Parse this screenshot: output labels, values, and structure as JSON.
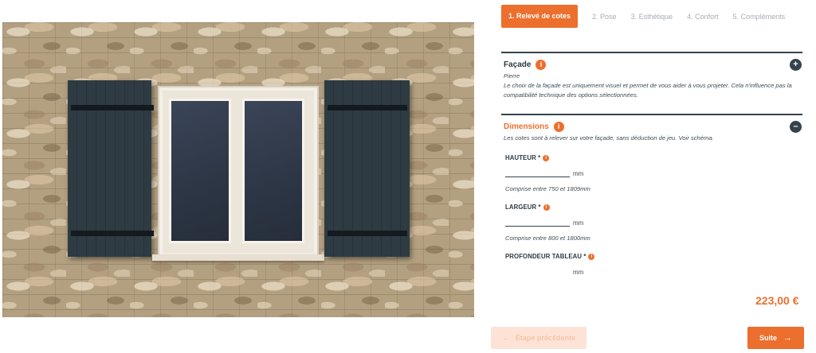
{
  "steps": [
    {
      "label": "1. Relevé de cotes",
      "active": true
    },
    {
      "label": "2. Pose"
    },
    {
      "label": "3. Esthétique"
    },
    {
      "label": "4. Confort"
    },
    {
      "label": "5. Compléments"
    }
  ],
  "facade": {
    "title": "Façade",
    "info_icon": "i",
    "toggle": "+",
    "value": "Pierre",
    "description": "Le choix de la façade est uniquement visuel et permet de vous aider à vous projeter. Cela n'influence pas la compatibilité technique des options sélectionnées."
  },
  "dimensions": {
    "title": "Dimensions",
    "info_icon": "i",
    "toggle": "–",
    "description": "Les cotes sont à relever sur votre façade, sans déduction de jeu. Voir schéma.",
    "fields": [
      {
        "label": "HAUTEUR *",
        "value": "",
        "unit": "mm",
        "hint": "Comprise entre 750 et 1809mm"
      },
      {
        "label": "LARGEUR *",
        "value": "",
        "unit": "mm",
        "hint": "Comprise entre 800 et 1800mm"
      },
      {
        "label": "PROFONDEUR TABLEAU *",
        "value": "",
        "unit": "mm"
      }
    ]
  },
  "price": "223,00 €",
  "buttons": {
    "prev_label": "Étape précédente",
    "prev_arrow": "←",
    "next_label": "Suite",
    "next_arrow": "→"
  },
  "colors": {
    "accent": "#ec6f2d",
    "dark": "#34434c",
    "shutter": "#2f3b42"
  }
}
